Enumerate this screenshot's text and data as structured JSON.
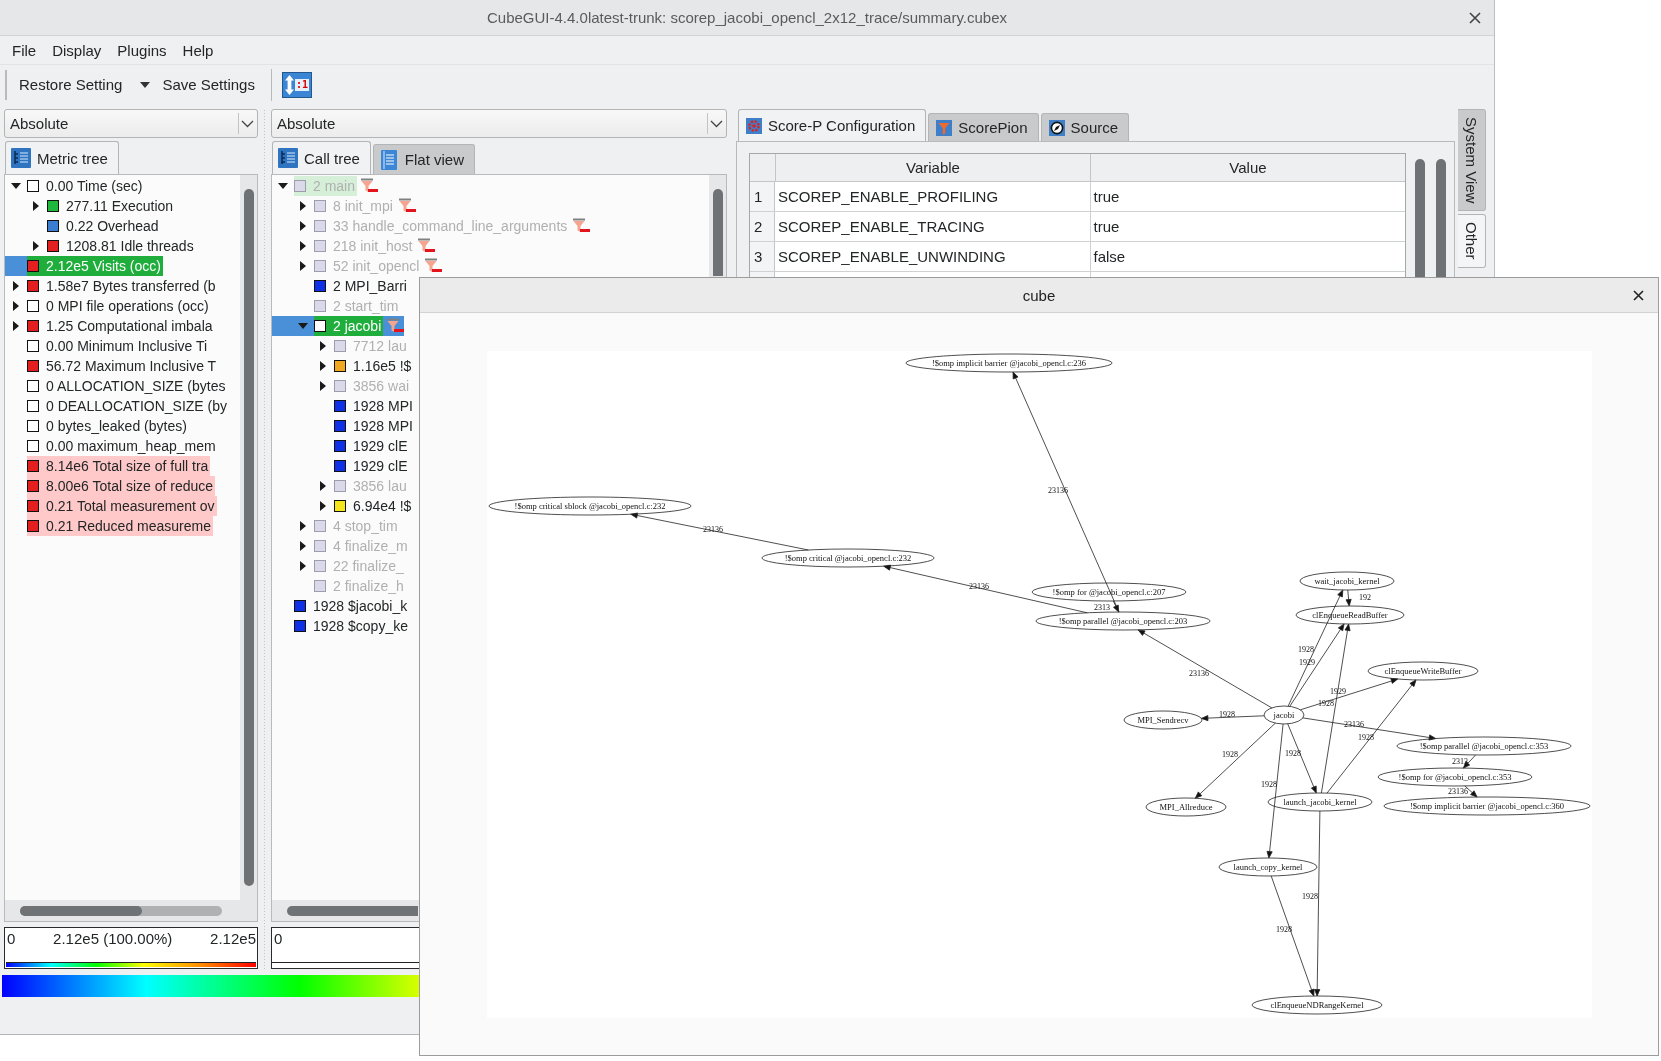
{
  "window": {
    "title": "CubeGUI-4.4.0latest-trunk: scorep_jacobi_opencl_2x12_trace/summary.cubex"
  },
  "menu": [
    "File",
    "Display",
    "Plugins",
    "Help"
  ],
  "toolbar": {
    "restore_button": "Restore Setting",
    "save_button": "Save Settings",
    "ratio_button": ":1"
  },
  "metric_pane": {
    "mode": "Absolute",
    "tabs": [
      {
        "label": "Metric tree",
        "selected": true
      }
    ],
    "tree": [
      {
        "label": "0.00 Time (sec)",
        "color": "#ffffff",
        "expanded": true,
        "selected": false,
        "highlighted": false,
        "children": [
          {
            "label": "277.11 Execution",
            "color": "#1fb83c",
            "expanded": false,
            "selected": false,
            "highlighted": false
          },
          {
            "label": "0.22 Overhead",
            "color": "#3a7dd1",
            "selected": false,
            "highlighted": false
          },
          {
            "label": "1208.81 Idle threads",
            "color": "#e3201f",
            "expanded": false,
            "selected": false,
            "highlighted": false
          }
        ]
      },
      {
        "label": "2.12e5 Visits (occ)",
        "color": "#e3201f",
        "selected": true,
        "highlighted": false
      },
      {
        "label": "1.58e7 Bytes transferred (b",
        "color": "#e3201f",
        "expanded": false,
        "selected": false,
        "highlighted": false
      },
      {
        "label": "0 MPI file operations (occ)",
        "color": "#ffffff",
        "expanded": false,
        "selected": false,
        "highlighted": false
      },
      {
        "label": "1.25 Computational imbala",
        "color": "#e3201f",
        "expanded": false,
        "selected": false,
        "highlighted": false
      },
      {
        "label": "0.00 Minimum Inclusive Ti",
        "color": "#ffffff",
        "selected": false,
        "highlighted": false
      },
      {
        "label": "56.72 Maximum Inclusive T",
        "color": "#e3201f",
        "selected": false,
        "highlighted": false
      },
      {
        "label": "0 ALLOCATION_SIZE (bytes",
        "color": "#ffffff",
        "selected": false,
        "highlighted": false
      },
      {
        "label": "0 DEALLOCATION_SIZE (by",
        "color": "#ffffff",
        "selected": false,
        "highlighted": false
      },
      {
        "label": "0 bytes_leaked (bytes)",
        "color": "#ffffff",
        "selected": false,
        "highlighted": false
      },
      {
        "label": "0.00 maximum_heap_mem",
        "color": "#ffffff",
        "selected": false,
        "highlighted": false
      },
      {
        "label": "8.14e6 Total size of full tra",
        "color": "#e3201f",
        "selected": false,
        "highlighted": true
      },
      {
        "label": "8.00e6 Total size of reduce",
        "color": "#e3201f",
        "selected": false,
        "highlighted": true
      },
      {
        "label": "0.21 Total measurement ov",
        "color": "#e3201f",
        "selected": false,
        "highlighted": true
      },
      {
        "label": "0.21 Reduced measureme",
        "color": "#e3201f",
        "selected": false,
        "highlighted": true
      }
    ],
    "value_bar": {
      "min": "0",
      "value": "2.12e5 (100.00%)",
      "max": "2.12e5"
    }
  },
  "call_pane": {
    "mode": "Absolute",
    "tabs": [
      {
        "label": "Call tree",
        "selected": true
      },
      {
        "label": "Flat view",
        "selected": false
      }
    ],
    "tree": [
      {
        "label": "2 main",
        "color": "#d9d9ea",
        "expanded": true,
        "selected": false,
        "highlighted": true,
        "dimmed": true,
        "filtered": true,
        "children": [
          {
            "label": "8 init_mpi",
            "color": "#d9d9ea",
            "expanded": false,
            "selected": false,
            "highlighted": false,
            "dimmed": true,
            "filtered": true
          },
          {
            "label": "33 handle_command_line_arguments",
            "color": "#d9d9ea",
            "expanded": false,
            "selected": false,
            "highlighted": false,
            "dimmed": true,
            "filtered": true
          },
          {
            "label": "218 init_host",
            "color": "#d9d9ea",
            "expanded": false,
            "selected": false,
            "highlighted": false,
            "dimmed": true,
            "filtered": true
          },
          {
            "label": "52 init_opencl",
            "color": "#d9d9ea",
            "expanded": false,
            "selected": false,
            "highlighted": false,
            "dimmed": true,
            "filtered": true
          },
          {
            "label": "2 MPI_Barri",
            "color": "#1030e6",
            "selected": false,
            "highlighted": false,
            "dimmed": false
          },
          {
            "label": "2 start_tim",
            "color": "#d9d9ea",
            "selected": false,
            "highlighted": false,
            "dimmed": true
          },
          {
            "label": "2 jacobi",
            "color": "#ffffff",
            "expanded": true,
            "selected": true,
            "highlighted": false,
            "dimmed": false,
            "filtered": true,
            "children": [
              {
                "label": "7712 lau",
                "color": "#d9d9ea",
                "expanded": false,
                "selected": false,
                "highlighted": false,
                "dimmed": true
              },
              {
                "label": "1.16e5 !$",
                "color": "#f0a820",
                "expanded": false,
                "selected": false,
                "highlighted": false,
                "dimmed": false
              },
              {
                "label": "3856 wai",
                "color": "#d9d9ea",
                "expanded": false,
                "selected": false,
                "highlighted": false,
                "dimmed": true
              },
              {
                "label": "1928 MPI",
                "color": "#1030e6",
                "selected": false,
                "highlighted": false,
                "dimmed": false
              },
              {
                "label": "1928 MPI",
                "color": "#1030e6",
                "selected": false,
                "highlighted": false,
                "dimmed": false
              },
              {
                "label": "1929 clE",
                "color": "#1030e6",
                "selected": false,
                "highlighted": false,
                "dimmed": false
              },
              {
                "label": "1929 clE",
                "color": "#1030e6",
                "selected": false,
                "highlighted": false,
                "dimmed": false
              },
              {
                "label": "3856 lau",
                "color": "#d9d9ea",
                "expanded": false,
                "selected": false,
                "highlighted": false,
                "dimmed": true
              },
              {
                "label": "6.94e4 !$",
                "color": "#f4e41c",
                "expanded": false,
                "selected": false,
                "highlighted": false,
                "dimmed": false
              }
            ]
          },
          {
            "label": "4 stop_tim",
            "color": "#d9d9ea",
            "expanded": false,
            "selected": false,
            "highlighted": false,
            "dimmed": true
          },
          {
            "label": "4 finalize_m",
            "color": "#d9d9ea",
            "expanded": false,
            "selected": false,
            "highlighted": false,
            "dimmed": true
          },
          {
            "label": "22 finalize_",
            "color": "#d9d9ea",
            "expanded": false,
            "selected": false,
            "highlighted": false,
            "dimmed": true
          },
          {
            "label": "2 finalize_h",
            "color": "#d9d9ea",
            "selected": false,
            "highlighted": false,
            "dimmed": true
          }
        ]
      },
      {
        "label": "1928 $jacobi_k",
        "color": "#1030e6",
        "selected": false,
        "highlighted": false,
        "dimmed": false
      },
      {
        "label": "1928 $copy_ke",
        "color": "#1030e6",
        "selected": false,
        "highlighted": false,
        "dimmed": false
      }
    ],
    "value_bar": {
      "min": "0"
    }
  },
  "system_pane": {
    "tabs": [
      {
        "label": "Score-P Configuration",
        "selected": true
      },
      {
        "label": "ScorePion",
        "selected": false
      },
      {
        "label": "Source",
        "selected": false
      }
    ],
    "table": {
      "columns": [
        "Variable",
        "Value"
      ],
      "rows": [
        {
          "number": "1",
          "variable": "SCOREP_ENABLE_PROFILING",
          "value": "true"
        },
        {
          "number": "2",
          "variable": "SCOREP_ENABLE_TRACING",
          "value": "true"
        },
        {
          "number": "3",
          "variable": "SCOREP_ENABLE_UNWINDING",
          "value": "false"
        }
      ]
    },
    "side_tabs": [
      {
        "label": "System View",
        "selected": false
      },
      {
        "label": "Other",
        "selected": true
      }
    ]
  },
  "dialog": {
    "title": "cube",
    "graph": {
      "nodes": [
        {
          "label": "!$omp implicit barrier @jacobi_opencl.c:236"
        },
        {
          "label": "!$omp critical sblock @jacobi_opencl.c:232"
        },
        {
          "label": "!$omp critical @jacobi_opencl.c:232"
        },
        {
          "label": "!$omp for @jacobi_opencl.c:207"
        },
        {
          "label": "wait_jacobi_kernel"
        },
        {
          "label": "!$omp parallel @jacobi_opencl.c:203"
        },
        {
          "label": "clEnqueueReadBuffer"
        },
        {
          "label": "clEnqueueWriteBuffer"
        },
        {
          "label": "MPI_Sendrecv"
        },
        {
          "label": "jacobi"
        },
        {
          "label": "!$omp parallel @jacobi_opencl.c:353"
        },
        {
          "label": "!$omp for @jacobi_opencl.c:353"
        },
        {
          "label": "MPI_Allreduce"
        },
        {
          "label": "launch_jacobi_kernel"
        },
        {
          "label": "!$omp implicit barrier @jacobi_opencl.c:360"
        },
        {
          "label": "launch_copy_kernel"
        },
        {
          "label": "clEnqueueNDRangeKernel"
        }
      ],
      "edges": [
        {
          "label": "23136"
        },
        {
          "label": "23136"
        },
        {
          "label": "23136"
        },
        {
          "label": "192"
        },
        {
          "label": "2313"
        },
        {
          "label": "1928"
        },
        {
          "label": "1929"
        },
        {
          "label": "23136"
        },
        {
          "label": "1929"
        },
        {
          "label": "1928"
        },
        {
          "label": "1928"
        },
        {
          "label": "23136"
        },
        {
          "label": "1928"
        },
        {
          "label": "1928"
        },
        {
          "label": "1928"
        },
        {
          "label": "2313"
        },
        {
          "label": "1928"
        },
        {
          "label": "23136"
        },
        {
          "label": "1928"
        },
        {
          "label": "1928"
        }
      ]
    }
  }
}
